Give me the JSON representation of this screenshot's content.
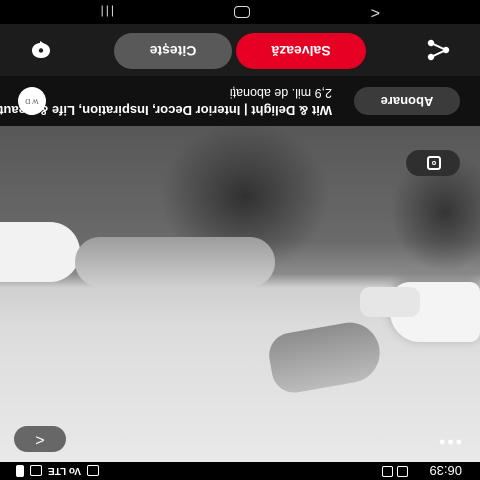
{
  "status_bar": {
    "time": "06:39",
    "signal_text": "Vo LTE"
  },
  "photo": {
    "menu_label": "•••",
    "back_label": "<",
    "lens_icon": "visual-search-icon"
  },
  "creator": {
    "name": "Wit & Delight | Interior Decor, Inspiration, Life & Beauty",
    "subscribers": "2,9 mil. de abonați",
    "avatar_text": "W D",
    "subscribe_label": "Abonare"
  },
  "actions": {
    "share_icon": "share-icon",
    "save_label": "Salvează",
    "read_label": "Citește",
    "comment_icon": "comment-icon",
    "save_color": "#e60023"
  },
  "navbar": {
    "back_label": "<",
    "recent_label": "|||"
  }
}
